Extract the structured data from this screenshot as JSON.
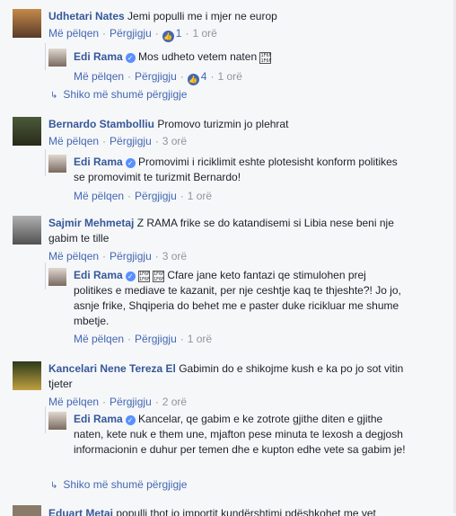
{
  "comments": [
    {
      "author": "Udhetari Nates",
      "text": "Jemi populli me i mjer ne europ",
      "like": "Më pëlqen",
      "reply": "Përgjigju",
      "likes": "1",
      "time": "1 orë",
      "avatar_color": "#8a6a4a"
    },
    {
      "author": "Bernardo Stambolliu",
      "text": "Promovo turizmin jo plehrat",
      "like": "Më pëlqen",
      "reply": "Përgjigju",
      "time": "3 orë",
      "avatar_color": "#5a4a3a"
    },
    {
      "author": "Sajmir Mehmetaj",
      "text_line1": "Z RAMA frike se do katandisemi si Libia nese beni nje",
      "text_line2": "gabim te tille",
      "like": "Më pëlqen",
      "reply": "Përgjigju",
      "time": "3 orë",
      "avatar_color": "#7a7a7a"
    },
    {
      "author": "Kancelari Nene Tereza El",
      "text_line1": "Gabimin do e shikojme kush e ka po jo sot vitin",
      "text_line2": "tjeter",
      "like": "Më pëlqen",
      "reply": "Përgjigju",
      "time": "2 orë",
      "avatar_color": "#3a5a2a"
    }
  ],
  "replies": [
    {
      "author": "Edi Rama",
      "text": "Mos udheto vetem naten",
      "like": "Më pëlqen",
      "reply": "Përgjigju",
      "likes": "4",
      "time": "1 orë"
    },
    {
      "author": "Edi Rama",
      "text_line1": "Promovimi i riciklimit eshte plotesisht konform politikes",
      "text_line2": "se promovimit te turizmit Bernardo!",
      "like": "Më pëlqen",
      "reply": "Përgjigju",
      "time": "1 orë"
    },
    {
      "author": "Edi Rama",
      "text_line1": "Cfare jane keto fantazi qe stimulohen prej",
      "text_line2": "politikes e mediave te kazanit, per nje ceshtje kaq te thjeshte?! Jo jo,",
      "text_line3": "asnje frike, Shqiperia do behet me e paster duke ricikluar me shume",
      "text_line4": "mbetje.",
      "like": "Më pëlqen",
      "reply": "Përgjigju",
      "time": "1 orë"
    },
    {
      "author": "Edi Rama",
      "text_line1": "Kancelar, qe gabim e ke zotrote gjithe diten e gjithe",
      "text_line2": "naten, kete nuk e them une, mjafton pese minuta te lexosh a degjosh",
      "text_line3": "informacionin e duhur per temen dhe e kupton edhe vete sa gabim je!",
      "like": "Më pëlqen",
      "reply": "Përgjigju",
      "time": "1 orë"
    }
  ],
  "more_replies": "Shiko më shumë përgjigje",
  "bottom_partial": {
    "author": "Eduart Metai",
    "text": "populli thot jo importit kundërshtimi pdëshkohet me vet"
  },
  "emoji_glyph": "1F6F 1F6F",
  "colors": {
    "link": "#4267b2",
    "author": "#365899",
    "meta": "#90949c",
    "bg": "#f6f7f9"
  }
}
